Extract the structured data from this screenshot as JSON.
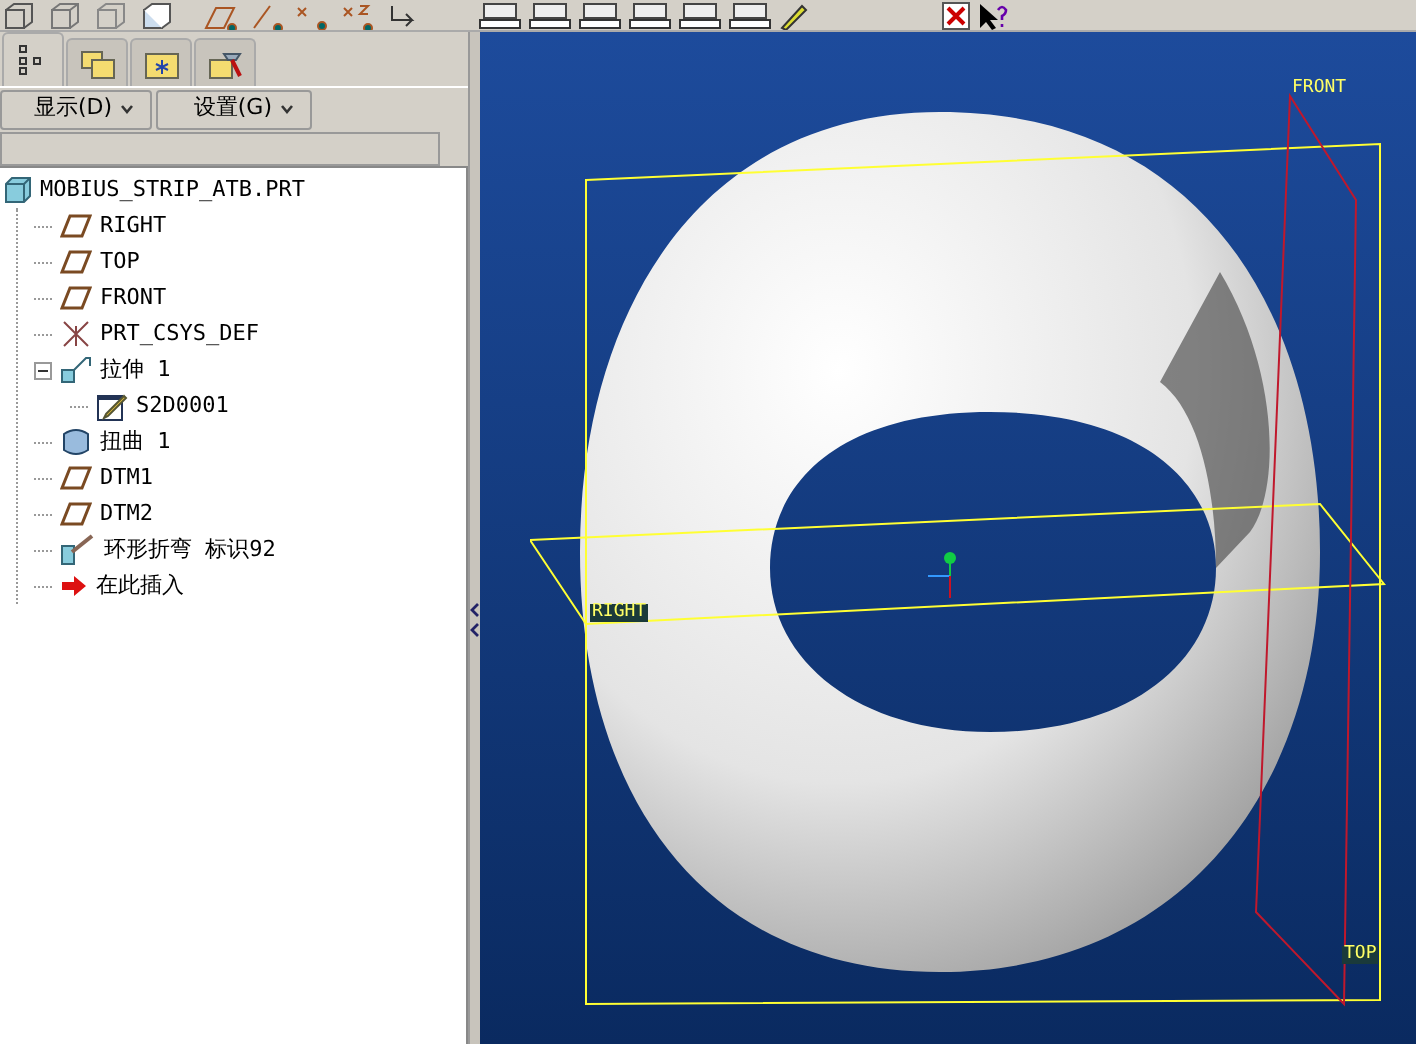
{
  "panel_tabs": [
    {
      "kind": "tree",
      "selected": true
    },
    {
      "kind": "folders",
      "selected": false
    },
    {
      "kind": "favorites",
      "selected": false
    },
    {
      "kind": "tools",
      "selected": false
    }
  ],
  "menus": [
    {
      "label": "显示(D)"
    },
    {
      "label": "设置(G)"
    }
  ],
  "tree": {
    "label": "MOBIUS_STRIP_ATB.PRT",
    "kind": "part",
    "children": [
      {
        "label": "RIGHT",
        "kind": "plane"
      },
      {
        "label": "TOP",
        "kind": "plane"
      },
      {
        "label": "FRONT",
        "kind": "plane"
      },
      {
        "label": "PRT_CSYS_DEF",
        "kind": "csys"
      },
      {
        "label": "拉伸 1",
        "kind": "extrude",
        "expanded": true,
        "children": [
          {
            "label": "S2D0001",
            "kind": "sketch"
          }
        ]
      },
      {
        "label": "扭曲 1",
        "kind": "warp"
      },
      {
        "label": "DTM1",
        "kind": "plane"
      },
      {
        "label": "DTM2",
        "kind": "plane"
      },
      {
        "label": "环形折弯 标识92",
        "kind": "bend"
      },
      {
        "label": "在此插入",
        "kind": "insert"
      }
    ]
  },
  "viewport": {
    "plane_labels": [
      {
        "label": "FRONT",
        "kind": "front"
      },
      {
        "label": "RIGHT",
        "kind": "right"
      },
      {
        "label": "TOP",
        "kind": "top"
      }
    ]
  }
}
